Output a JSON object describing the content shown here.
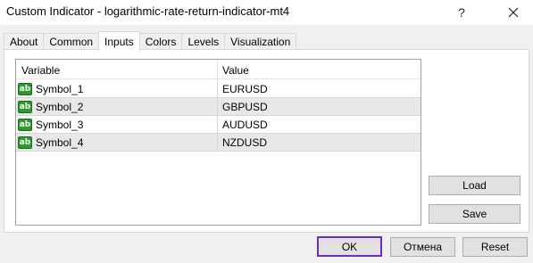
{
  "window": {
    "title": "Custom Indicator - logarithmic-rate-return-indicator-mt4",
    "help_label": "?",
    "close_icon": "close-icon"
  },
  "tabs": [
    {
      "label": "About"
    },
    {
      "label": "Common"
    },
    {
      "label": "Inputs",
      "active": true
    },
    {
      "label": "Colors"
    },
    {
      "label": "Levels"
    },
    {
      "label": "Visualization"
    }
  ],
  "grid": {
    "headers": {
      "variable": "Variable",
      "value": "Value"
    },
    "icon_label": "ab",
    "rows": [
      {
        "variable": "Symbol_1",
        "value": "EURUSD"
      },
      {
        "variable": "Symbol_2",
        "value": "GBPUSD"
      },
      {
        "variable": "Symbol_3",
        "value": "AUDUSD"
      },
      {
        "variable": "Symbol_4",
        "value": "NZDUSD"
      }
    ]
  },
  "side_buttons": {
    "load": "Load",
    "save": "Save"
  },
  "footer_buttons": {
    "ok": "OK",
    "cancel": "Отмена",
    "reset": "Reset"
  },
  "colors": {
    "ok_focus_border": "#6a2dbd",
    "string_icon": "#2e9a2e"
  }
}
